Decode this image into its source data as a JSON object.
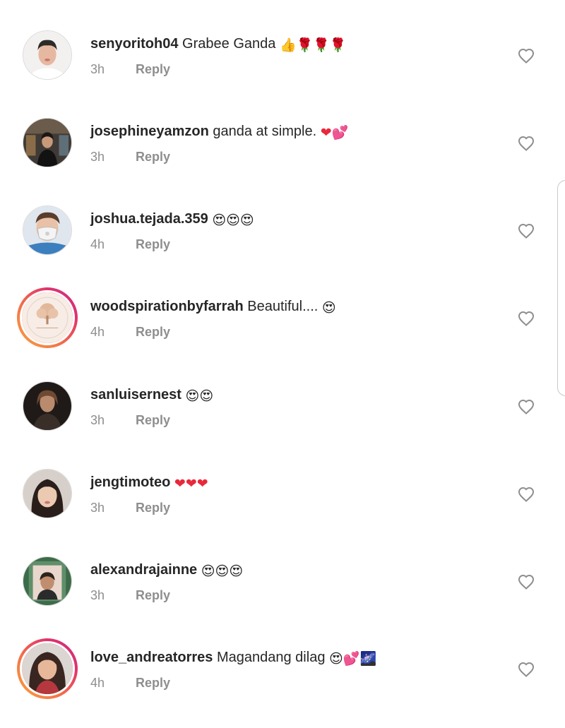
{
  "comments": [
    {
      "username": "senyoritoh04",
      "text": "Grabee Ganda",
      "emojis": "👍🌹🌹🌹",
      "time": "3h",
      "reply": "Reply",
      "avatar": "man-portrait",
      "story_ring": false
    },
    {
      "username": "josephineyamzon",
      "text": "ganda  at simple.",
      "emojis": "❤💕",
      "time": "3h",
      "reply": "Reply",
      "avatar": "woman-in-shop",
      "story_ring": false
    },
    {
      "username": "joshua.tejada.359",
      "text": "",
      "emojis": "😍😍😍",
      "time": "4h",
      "reply": "Reply",
      "avatar": "masked-face",
      "story_ring": false
    },
    {
      "username": "woodspirationbyfarrah",
      "text": "Beautiful....",
      "emojis": "😍",
      "time": "4h",
      "reply": "Reply",
      "avatar": "tree-logo",
      "story_ring": true
    },
    {
      "username": "sanluisernest",
      "text": "",
      "emojis": "😍😍",
      "time": "3h",
      "reply": "Reply",
      "avatar": "dark-portrait",
      "story_ring": false
    },
    {
      "username": "jengtimoteo",
      "text": "",
      "emojis": "❤❤❤",
      "time": "3h",
      "reply": "Reply",
      "avatar": "girl-selfie",
      "story_ring": false
    },
    {
      "username": "alexandrajainne",
      "text": "",
      "emojis": "😍😍😍",
      "time": "3h",
      "reply": "Reply",
      "avatar": "mirror-selfie",
      "story_ring": false
    },
    {
      "username": "love_andreatorres",
      "text": "Magandang dilag",
      "emojis": "😍💕🌌",
      "time": "4h",
      "reply": "Reply",
      "avatar": "woman-portrait",
      "story_ring": true
    }
  ],
  "icons": {
    "like": "heart-outline-icon"
  },
  "colors": {
    "text": "#262626",
    "secondary_text": "#8e8e8e",
    "heart_outline": "#8e8e8e",
    "story_ring_start": "#f9a440",
    "story_ring_end": "#c13584",
    "emoji_heart": "#e8293b"
  }
}
